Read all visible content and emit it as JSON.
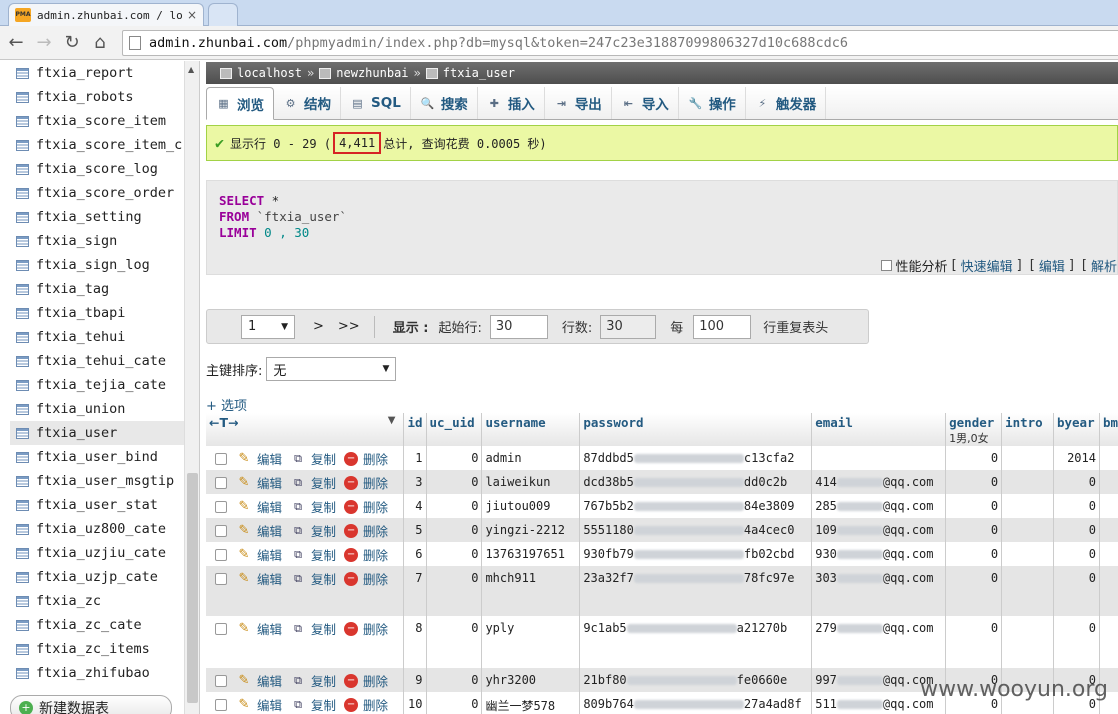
{
  "browser": {
    "tab_title": "admin.zhunbai.com / loc",
    "tab_favicon_text": "PMA",
    "url_host": "admin.zhunbai.com",
    "url_path": "/phpmyadmin/index.php?db=mysql&token=247c23e31887099806327d10c688cdc6"
  },
  "nav": {
    "tables": [
      "ftxia_report",
      "ftxia_robots",
      "ftxia_score_item",
      "ftxia_score_item_c",
      "ftxia_score_log",
      "ftxia_score_order",
      "ftxia_setting",
      "ftxia_sign",
      "ftxia_sign_log",
      "ftxia_tag",
      "ftxia_tbapi",
      "ftxia_tehui",
      "ftxia_tehui_cate",
      "ftxia_tejia_cate",
      "ftxia_union",
      "ftxia_user",
      "ftxia_user_bind",
      "ftxia_user_msgtip",
      "ftxia_user_stat",
      "ftxia_uz800_cate",
      "ftxia_uzjiu_cate",
      "ftxia_uzjp_cate",
      "ftxia_zc",
      "ftxia_zc_cate",
      "ftxia_zc_items",
      "ftxia_zhifubao"
    ],
    "active_table": "ftxia_user",
    "new_table_label": "新建数据表"
  },
  "breadcrumb": {
    "server": "localhost",
    "database": "newzhunbai",
    "table": "ftxia_user",
    "sep": "»"
  },
  "tabs": [
    {
      "label": "浏览",
      "icon": "browse-icon",
      "glyph": "▦"
    },
    {
      "label": "结构",
      "icon": "structure-icon",
      "glyph": "⚙"
    },
    {
      "label": "SQL",
      "icon": "sql-icon",
      "glyph": "▤"
    },
    {
      "label": "搜索",
      "icon": "search-icon",
      "glyph": "🔍"
    },
    {
      "label": "插入",
      "icon": "insert-icon",
      "glyph": "✚"
    },
    {
      "label": "导出",
      "icon": "export-icon",
      "glyph": "⇥"
    },
    {
      "label": "导入",
      "icon": "import-icon",
      "glyph": "⇤"
    },
    {
      "label": "操作",
      "icon": "operations-icon",
      "glyph": "🔧"
    },
    {
      "label": "触发器",
      "icon": "triggers-icon",
      "glyph": "⚡"
    }
  ],
  "success": {
    "prefix": "显示行 0 - 29 (",
    "total": "4,411",
    "suffix": "总计, 查询花费 0.0005 秒)"
  },
  "sql": {
    "select_kw": "SELECT",
    "star": " *",
    "from_kw": "FROM",
    "table": " `ftxia_user`",
    "limit_kw": "LIMIT",
    "limit_vals": " 0 , 30"
  },
  "sql_links": {
    "profiling": "性能分析",
    "inline_edit": "快速编辑",
    "edit": "编辑",
    "explain": "解析",
    "lb": "[",
    "rb": "]"
  },
  "pager": {
    "page": "1",
    "next": ">",
    "last": ">>",
    "show_label": "显示 :",
    "start_label": "起始行:",
    "start_value": "30",
    "rows_label": "行数:",
    "rows_value": "30",
    "every_label": "每",
    "repeat_value": "100",
    "repeat_label": "行重复表头"
  },
  "sort": {
    "label": "主键排序:",
    "value": "无"
  },
  "options_label": "+ 选项",
  "table": {
    "arrows": "←T→",
    "columns": [
      "id",
      "uc_uid",
      "username",
      "password",
      "email",
      "gender",
      "intro",
      "byear",
      "bm"
    ],
    "gender_note": "1男,0女",
    "actions": {
      "edit": "编辑",
      "copy": "复制",
      "delete": "删除"
    },
    "rows": [
      {
        "id": "1",
        "uc_uid": "0",
        "username": "admin",
        "pw_start": "87ddbd5",
        "pw_end": "c13cfa2",
        "email_start": "",
        "email_end": "",
        "gender": "0",
        "intro": "",
        "byear": "2014"
      },
      {
        "id": "3",
        "uc_uid": "0",
        "username": "laiweikun",
        "pw_start": "dcd38b5",
        "pw_end": "dd0c2b",
        "email_start": "414",
        "email_end": "@qq.com",
        "gender": "0",
        "intro": "",
        "byear": "0"
      },
      {
        "id": "4",
        "uc_uid": "0",
        "username": "jiutou009",
        "pw_start": "767b5b2",
        "pw_end": "84e3809",
        "email_start": "285",
        "email_end": "@qq.com",
        "gender": "0",
        "intro": "",
        "byear": "0"
      },
      {
        "id": "5",
        "uc_uid": "0",
        "username": "yingzi-2212",
        "pw_start": "5551180",
        "pw_end": "4a4cec0",
        "email_start": "109",
        "email_end": "@qq.com",
        "gender": "0",
        "intro": "",
        "byear": "0"
      },
      {
        "id": "6",
        "uc_uid": "0",
        "username": "13763197651",
        "pw_start": "930fb79",
        "pw_end": "fb02cbd",
        "email_start": "930",
        "email_end": "@qq.com",
        "gender": "0",
        "intro": "",
        "byear": "0"
      },
      {
        "id": "7",
        "uc_uid": "0",
        "username": "mhch911",
        "pw_start": "23a32f7",
        "pw_end": "78fc97e",
        "email_start": "303",
        "email_end": "@qq.com",
        "gender": "0",
        "intro": "",
        "byear": "0"
      },
      {
        "id": "8",
        "uc_uid": "0",
        "username": "yply",
        "pw_start": "9c1ab5",
        "pw_end": "a21270b",
        "email_start": "279",
        "email_end": "@qq.com",
        "gender": "0",
        "intro": "",
        "byear": "0"
      },
      {
        "id": "9",
        "uc_uid": "0",
        "username": "yhr3200",
        "pw_start": "21bf80",
        "pw_end": "fe0660e",
        "email_start": "997",
        "email_end": "@qq.com",
        "gender": "0",
        "intro": "",
        "byear": "0"
      },
      {
        "id": "10",
        "uc_uid": "0",
        "username": "幽兰一梦578",
        "pw_start": "809b764",
        "pw_end": "27a4ad8f",
        "email_start": "511",
        "email_end": "@qq.com",
        "gender": "0",
        "intro": "",
        "byear": "0"
      }
    ]
  },
  "watermark": "www.wooyun.org"
}
